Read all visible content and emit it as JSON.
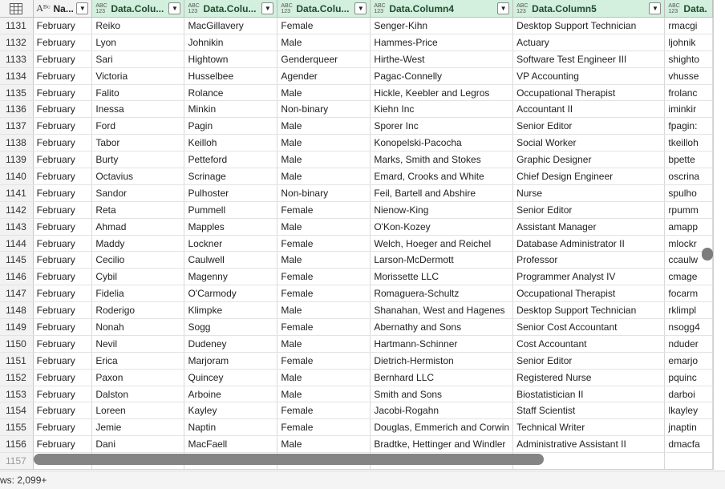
{
  "columns": [
    {
      "label": "Na...",
      "type": "text",
      "type_icon": "text-type-icon"
    },
    {
      "label": "Data.Colu...",
      "type": "any",
      "type_icon": "any-type-icon"
    },
    {
      "label": "Data.Colu...",
      "type": "any",
      "type_icon": "any-type-icon"
    },
    {
      "label": "Data.Colu...",
      "type": "any",
      "type_icon": "any-type-icon"
    },
    {
      "label": "Data.Column4",
      "type": "any",
      "type_icon": "any-type-icon"
    },
    {
      "label": "Data.Column5",
      "type": "any",
      "type_icon": "any-type-icon"
    },
    {
      "label": "Data.",
      "type": "any",
      "type_icon": "any-type-icon"
    }
  ],
  "type_badge": {
    "line1": "ABC",
    "line2": "123",
    "text_glyph": "Aᴮᶜ"
  },
  "rows": [
    [
      "1131",
      "February",
      "Reiko",
      "MacGillavery",
      "Female",
      "Senger-Kihn",
      "Desktop Support Technician",
      "rmacgi"
    ],
    [
      "1132",
      "February",
      "Lyon",
      "Johnikin",
      "Male",
      "Hammes-Price",
      "Actuary",
      "ljohnik"
    ],
    [
      "1133",
      "February",
      "Sari",
      "Hightown",
      "Genderqueer",
      "Hirthe-West",
      "Software Test Engineer III",
      "shighto"
    ],
    [
      "1134",
      "February",
      "Victoria",
      "Husselbee",
      "Agender",
      "Pagac-Connelly",
      "VP Accounting",
      "vhusse"
    ],
    [
      "1135",
      "February",
      "Falito",
      "Rolance",
      "Male",
      "Hickle, Keebler and Legros",
      "Occupational Therapist",
      "frolanc"
    ],
    [
      "1136",
      "February",
      "Inessa",
      "Minkin",
      "Non-binary",
      "Kiehn Inc",
      "Accountant II",
      "iminkir"
    ],
    [
      "1137",
      "February",
      "Ford",
      "Pagin",
      "Male",
      "Sporer Inc",
      "Senior Editor",
      "fpagin:"
    ],
    [
      "1138",
      "February",
      "Tabor",
      "Keilloh",
      "Male",
      "Konopelski-Pacocha",
      "Social Worker",
      "tkeilloh"
    ],
    [
      "1139",
      "February",
      "Burty",
      "Petteford",
      "Male",
      "Marks, Smith and Stokes",
      "Graphic Designer",
      "bpette"
    ],
    [
      "1140",
      "February",
      "Octavius",
      "Scrinage",
      "Male",
      "Emard, Crooks and White",
      "Chief Design Engineer",
      "oscrina"
    ],
    [
      "1141",
      "February",
      "Sandor",
      "Pulhoster",
      "Non-binary",
      "Feil, Bartell and Abshire",
      "Nurse",
      "spulho"
    ],
    [
      "1142",
      "February",
      "Reta",
      "Pummell",
      "Female",
      "Nienow-King",
      "Senior Editor",
      "rpumm"
    ],
    [
      "1143",
      "February",
      "Ahmad",
      "Mapples",
      "Male",
      "O'Kon-Kozey",
      "Assistant Manager",
      "amapp"
    ],
    [
      "1144",
      "February",
      "Maddy",
      "Lockner",
      "Female",
      "Welch, Hoeger and Reichel",
      "Database Administrator II",
      "mlockr"
    ],
    [
      "1145",
      "February",
      "Cecilio",
      "Caulwell",
      "Male",
      "Larson-McDermott",
      "Professor",
      "ccaulw"
    ],
    [
      "1146",
      "February",
      "Cybil",
      "Magenny",
      "Female",
      "Morissette LLC",
      "Programmer Analyst IV",
      "cmage"
    ],
    [
      "1147",
      "February",
      "Fidelia",
      "O'Carmody",
      "Female",
      "Romaguera-Schultz",
      "Occupational Therapist",
      "focarm"
    ],
    [
      "1148",
      "February",
      "Roderigo",
      "Klimpke",
      "Male",
      "Shanahan, West and Hagenes",
      "Desktop Support Technician",
      "rklimpl"
    ],
    [
      "1149",
      "February",
      "Nonah",
      "Sogg",
      "Female",
      "Abernathy and Sons",
      "Senior Cost Accountant",
      "nsogg4"
    ],
    [
      "1150",
      "February",
      "Nevil",
      "Dudeney",
      "Male",
      "Hartmann-Schinner",
      "Cost Accountant",
      "nduder"
    ],
    [
      "1151",
      "February",
      "Erica",
      "Marjoram",
      "Female",
      "Dietrich-Hermiston",
      "Senior Editor",
      "emarjo"
    ],
    [
      "1152",
      "February",
      "Paxon",
      "Quincey",
      "Male",
      "Bernhard LLC",
      "Registered Nurse",
      "pquinc"
    ],
    [
      "1153",
      "February",
      "Dalston",
      "Arboine",
      "Male",
      "Smith and Sons",
      "Biostatistician II",
      "darboi"
    ],
    [
      "1154",
      "February",
      "Loreen",
      "Kayley",
      "Female",
      "Jacobi-Rogahn",
      "Staff Scientist",
      "lkayley"
    ],
    [
      "1155",
      "February",
      "Jemie",
      "Naptin",
      "Female",
      "Douglas, Emmerich and Corwin",
      "Technical Writer",
      "jnaptin"
    ],
    [
      "1156",
      "February",
      "Dani",
      "MacFaell",
      "Male",
      "Bradtke, Hettinger and Windler",
      "Administrative Assistant II",
      "dmacfa"
    ],
    [
      "1157",
      "",
      "",
      "",
      "",
      "",
      "",
      ""
    ]
  ],
  "status": {
    "row_count": "ws: 2,099+"
  },
  "colors": {
    "header_green": "#d3efdd",
    "scrollbar": "#7d7d7d"
  }
}
